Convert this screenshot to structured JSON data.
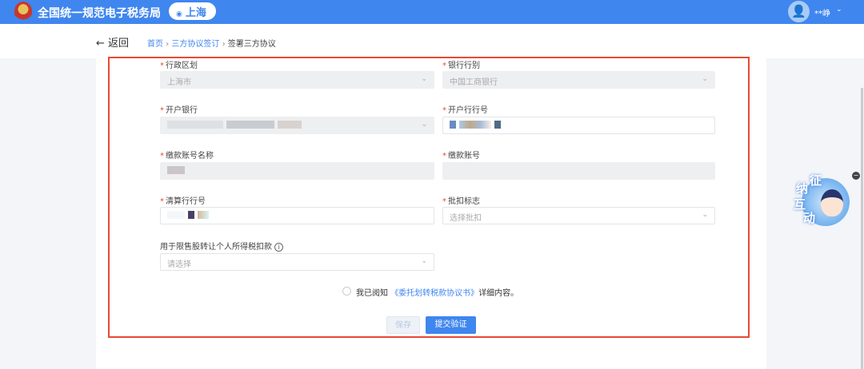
{
  "header": {
    "title": "全国统一规范电子税务局",
    "location": "上海",
    "pin_icon": "◉",
    "user": "**峥",
    "avatar_icon": "👤",
    "chevron": "⌄"
  },
  "nav": {
    "back_arrow": "←",
    "back_label": "返回",
    "breadcrumb": [
      "首页",
      "三方协议签订",
      "签署三方协议"
    ],
    "separator": "›"
  },
  "form": {
    "region": {
      "label": "行政区划",
      "value": "上海市"
    },
    "bank_type": {
      "label": "银行行别",
      "value": "中国工商银行"
    },
    "open_bank": {
      "label": "开户银行"
    },
    "open_bank_no": {
      "label": "开户行行号"
    },
    "account_name": {
      "label": "缴款账号名称"
    },
    "account_no": {
      "label": "缴款账号"
    },
    "clearing_no": {
      "label": "清算行行号"
    },
    "deduct_flag": {
      "label": "批扣标志",
      "placeholder": "选择批扣"
    },
    "restricted_stock": {
      "label": "用于限售股转让个人所得税扣款",
      "info": "i",
      "placeholder": "请选择"
    },
    "required_mark": "*",
    "dropdown_arrow": "⌄"
  },
  "agreement": {
    "prefix": "我已阅知",
    "link": "《委托划转税款协议书》",
    "suffix": "详细内容。"
  },
  "buttons": {
    "save": "保存",
    "submit": "提交验证"
  },
  "mascot": {
    "chars": [
      "征",
      "纳",
      "互",
      "动"
    ],
    "close": "−"
  }
}
